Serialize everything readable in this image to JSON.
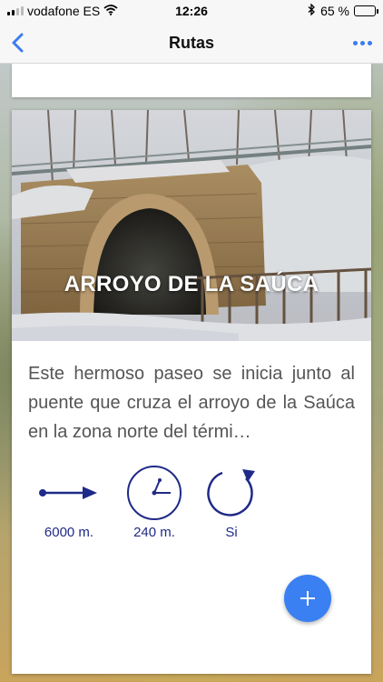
{
  "status_bar": {
    "carrier": "vodafone ES",
    "time": "12:26",
    "battery": "65 %",
    "battery_level": 0.65
  },
  "nav": {
    "title": "Rutas",
    "back_icon": "chevron-left-icon",
    "more_icon": "ellipsis-icon",
    "accent_color": "#3a7df0"
  },
  "route": {
    "name": "ARROYO DE LA SAÚCA",
    "description": "Este hermoso paseo se inicia junto al puente que cruza el arroyo de la Saúca en la zona norte del térmi…",
    "stats": [
      {
        "icon": "distance-arrow-icon",
        "label": "6000 m."
      },
      {
        "icon": "clock-icon",
        "label": "240 m."
      },
      {
        "icon": "circular-route-icon",
        "label": "Si"
      }
    ],
    "stat_color": "#1f2a88"
  },
  "fab": {
    "icon": "plus-icon",
    "color": "#3a80f2"
  }
}
